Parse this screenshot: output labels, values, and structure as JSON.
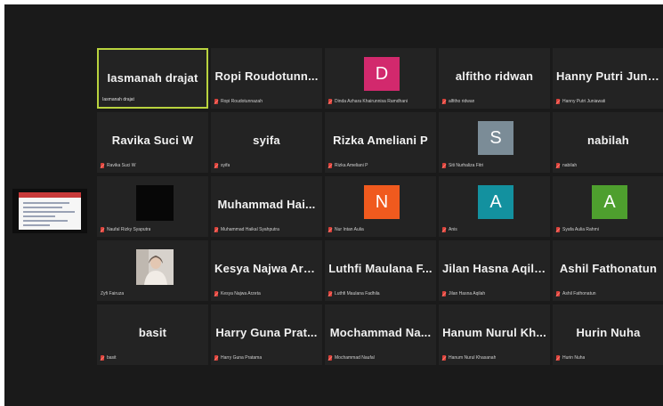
{
  "participants": [
    {
      "name": "Iasmanah drajat",
      "label": "Iasmanah drajat",
      "active": true
    },
    {
      "name": "Ropi  Roudotunn...",
      "label": "Ropi Roudotunnazah",
      "muted": true
    },
    {
      "avatar": "D",
      "color": "#d2296d",
      "label": "Dinda Azhara Khairunnisa Ramdhani",
      "muted": true
    },
    {
      "name": "alfitho ridwan",
      "label": "alfitho ridwan",
      "muted": true
    },
    {
      "name": "Hanny Putri Juni...",
      "label": "Hanny Putri Juniawati",
      "muted": true
    },
    {
      "name": "Ravika Suci W",
      "label": "Ravika Suci W",
      "muted": true
    },
    {
      "name": "syifa",
      "label": "syifa",
      "muted": true
    },
    {
      "name": "Rizka Ameliani P",
      "label": "Rizka Ameliani P",
      "muted": true
    },
    {
      "avatar": "S",
      "color": "#7b8c97",
      "label": "Siti Nurhaliza Fitri",
      "muted": true
    },
    {
      "name": "nabilah",
      "label": "nabilah",
      "muted": true
    },
    {
      "video": "dark",
      "label": "Naufal Rizky Syaputra",
      "muted": true
    },
    {
      "name": "Muhammad  Hai...",
      "label": "Muhammad Haikal Syahputra",
      "muted": true
    },
    {
      "avatar": "N",
      "color": "#f05a1e",
      "label": "Nur Intan Aulia",
      "muted": true
    },
    {
      "avatar": "A",
      "color": "#13919f",
      "label": "Anis",
      "muted": true
    },
    {
      "avatar": "A",
      "color": "#4e9f2e",
      "label": "Syafa Aulia Rahmi",
      "muted": true
    },
    {
      "video": "person",
      "label": "Zyfi Fairuza",
      "muted": false
    },
    {
      "name": "Kesya Najwa Arz...",
      "label": "Kesya Najwa Arzeta",
      "muted": true
    },
    {
      "name": "Luthfi Maulana F...",
      "label": "Luthfi Maulana Fadhila",
      "muted": true
    },
    {
      "name": "Jilan Hasna Aqilah",
      "label": "Jilan Hasna Aqilah",
      "muted": true
    },
    {
      "name": "Ashil Fathonatun",
      "label": "Ashil Fathonatun",
      "muted": true
    },
    {
      "name": "basit",
      "label": "basit",
      "muted": true
    },
    {
      "name": "Harry Guna Prat...",
      "label": "Harry Guna Pratama",
      "muted": true
    },
    {
      "name": "Mochammad  Na...",
      "label": "Mochammad Naufal",
      "muted": true
    },
    {
      "name": "Hanum Nurul Kh...",
      "label": "Hanum Nurul Khasanah",
      "muted": true
    },
    {
      "name": "Hurin Nuha",
      "label": "Hurin Nuha",
      "muted": true
    }
  ]
}
